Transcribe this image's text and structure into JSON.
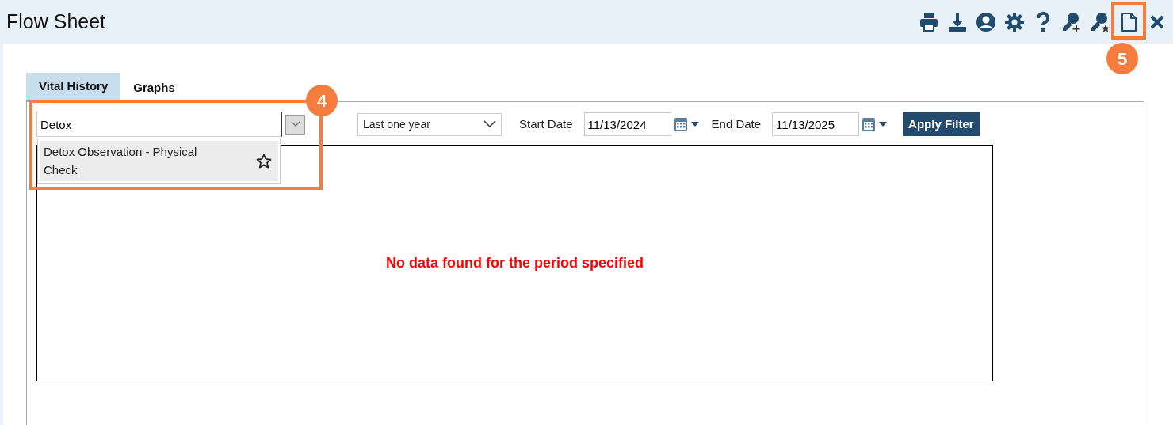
{
  "window": {
    "title": "Flow Sheet"
  },
  "toolbar": [
    {
      "kind": "print"
    },
    {
      "kind": "download"
    },
    {
      "kind": "user"
    },
    {
      "kind": "settings"
    },
    {
      "kind": "help"
    },
    {
      "kind": "key-plus"
    },
    {
      "kind": "key-star"
    },
    {
      "kind": "document",
      "callout": "5"
    },
    {
      "kind": "close"
    }
  ],
  "tabs": [
    {
      "label": "Vital History",
      "selected": true
    },
    {
      "label": "Graphs",
      "selected": false
    }
  ],
  "flowsheet_search": {
    "value": "Detox",
    "callout": "4",
    "suggestions": [
      {
        "label": "Detox Observation - Physical Check",
        "favorite": false
      }
    ]
  },
  "period": {
    "value": "Last one year"
  },
  "start_date": {
    "label": "Start Date",
    "value": "11/13/2024"
  },
  "end_date": {
    "label": "End Date",
    "value": "11/13/2025"
  },
  "apply_button": "Apply Filter",
  "message": "No data found for the period specified"
}
